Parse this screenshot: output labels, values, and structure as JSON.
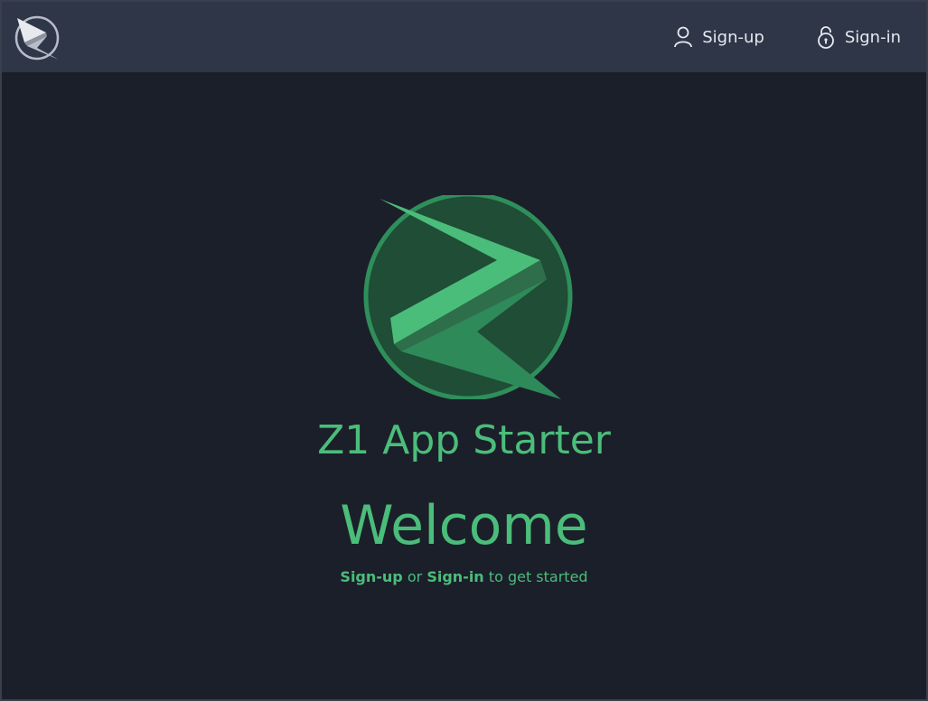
{
  "colors": {
    "page_background": "#1b1f2a",
    "topbar_background": "#2e3648",
    "accent_green": "#4bbd7a",
    "logo_circle_fill": "#1f4d36",
    "logo_ring": "#2f8f5b",
    "nav_text": "#e6e8ee"
  },
  "header": {
    "brand_icon": "z1-logo-icon",
    "nav": [
      {
        "label": "Sign-up",
        "icon": "user-icon"
      },
      {
        "label": "Sign-in",
        "icon": "unlock-icon"
      }
    ]
  },
  "hero": {
    "logo_icon": "z1-logo-icon",
    "app_title": "Z1 App Starter",
    "welcome": "Welcome",
    "subtext": {
      "signup_link": "Sign-up",
      "or": "or",
      "signin_link": "Sign-in",
      "tail": "to get started"
    }
  }
}
